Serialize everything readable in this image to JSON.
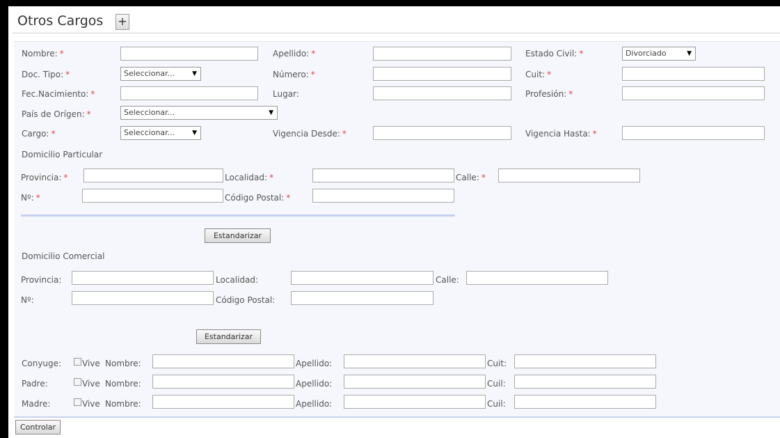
{
  "header": {
    "title": "Otros Cargos",
    "add_label": "+"
  },
  "personal": {
    "nombre_label": "Nombre:",
    "apellido_label": "Apellido:",
    "estado_civil_label": "Estado Civil:",
    "estado_civil_value": "Divorciado",
    "doc_tipo_label": "Doc. Tipo:",
    "doc_tipo_value": "Seleccionar...",
    "numero_label": "Número:",
    "cuit_label": "Cuit:",
    "fec_nacimiento_label": "Fec.Nacimiento:",
    "lugar_label": "Lugar:",
    "profesion_label": "Profesión:",
    "pais_label": "País de Orígen:",
    "pais_value": "Seleccionar...",
    "cargo_label": "Cargo:",
    "cargo_value": "Seleccionar...",
    "vigencia_desde_label": "Vigencia Desde:",
    "vigencia_hasta_label": "Vigencia Hasta:",
    "required_mark": "*"
  },
  "domicilio_particular": {
    "title": "Domicilio Particular",
    "provincia_label": "Provincia:",
    "localidad_label": "Localidad:",
    "calle_label": "Calle:",
    "numero_label": "Nº:",
    "codigo_postal_label": "Código Postal:",
    "button_label": "Estandarizar"
  },
  "domicilio_comercial": {
    "title": "Domicilio Comercial",
    "provincia_label": "Provincia:",
    "localidad_label": "Localidad:",
    "calle_label": "Calle:",
    "numero_label": "Nº:",
    "codigo_postal_label": "Código Postal:",
    "button_label": "Estandarizar"
  },
  "familia": [
    {
      "label": "Conyuge:",
      "vive_label": "Vive",
      "nombre_label": "Nombre:",
      "apellido_label": "Apellido:",
      "id_label": "Cuit:"
    },
    {
      "label": "Padre:",
      "vive_label": "Vive",
      "nombre_label": "Nombre:",
      "apellido_label": "Apellido:",
      "id_label": "Cuil:"
    },
    {
      "label": "Madre:",
      "vive_label": "Vive",
      "nombre_label": "Nombre:",
      "apellido_label": "Apellido:",
      "id_label": "Cuil:"
    }
  ],
  "footer": {
    "controlar_label": "Controlar"
  }
}
